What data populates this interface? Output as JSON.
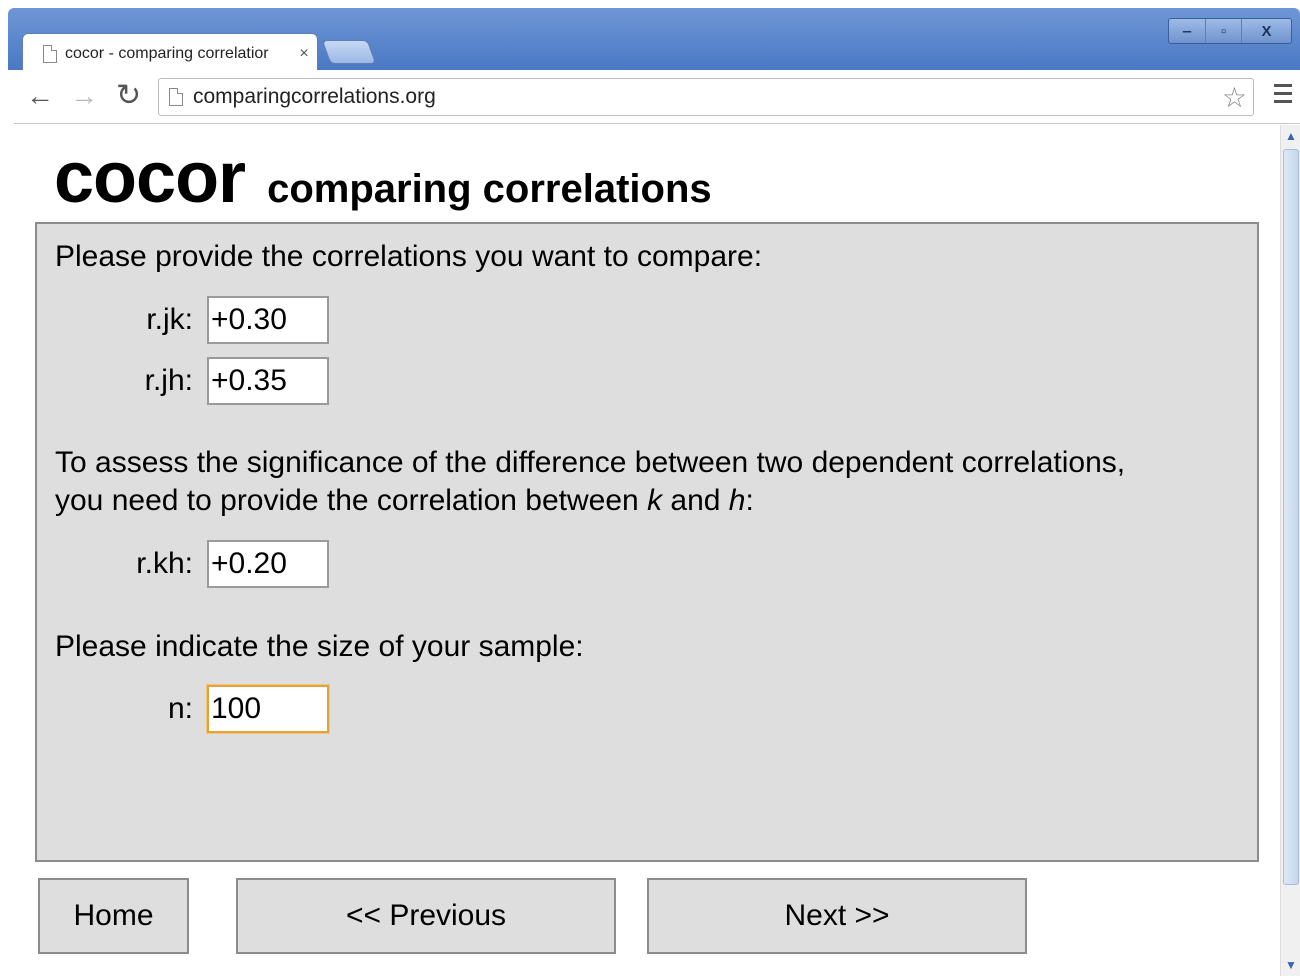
{
  "browser": {
    "tab_title": "cocor - comparing correlatior",
    "tab_close": "×",
    "url": "comparingcorrelations.org",
    "window_controls": {
      "minimize": "‒",
      "maximize": "▫",
      "close": "X"
    }
  },
  "header": {
    "logo": "cocor",
    "subtitle": "comparing correlations"
  },
  "form": {
    "intro": "Please provide the correlations you want to compare:",
    "fields_top": [
      {
        "label": "r.jk:",
        "value": "+0.30"
      },
      {
        "label": "r.jh:",
        "value": "+0.35"
      }
    ],
    "dependent_text_line1": "To assess the significance of the difference between two dependent correlations,",
    "dependent_text_line2_prefix": "you need to provide the correlation between ",
    "var_k": "k",
    "and_word": " and ",
    "var_h": "h",
    "colon": ":",
    "field_kh": {
      "label": "r.kh:",
      "value": "+0.20"
    },
    "sample_text": "Please indicate the size of your sample:",
    "field_n": {
      "label": "n:",
      "value": "100"
    }
  },
  "buttons": {
    "home": "Home",
    "previous": "<< Previous",
    "next": "Next >>"
  }
}
